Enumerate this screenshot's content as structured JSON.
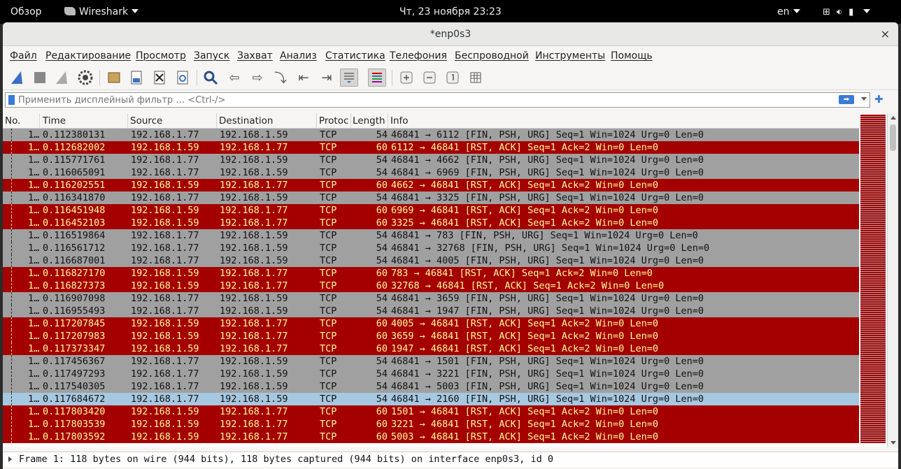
{
  "topbar": {
    "overview": "Обзор",
    "app_name": "Wireshark",
    "clock": "Чт, 23 ноября  23:23",
    "lang": "en"
  },
  "window": {
    "title": "*enp0s3",
    "close": "×"
  },
  "menu": [
    "Файл",
    "Редактирование",
    "Просмотр",
    "Запуск",
    "Захват",
    "Анализ",
    "Статистика",
    "Телефония",
    "Беспроводной",
    "Инструменты",
    "Помощь"
  ],
  "filter": {
    "placeholder": "Применить дисплейный фильтр … <Ctrl-/>"
  },
  "columns": [
    "No.",
    "Time",
    "Source",
    "Destination",
    "Protoc",
    "Length",
    "Info"
  ],
  "colors": {
    "syn_row_bg": "#a0a0a0",
    "rst_row_bg": "#a40000",
    "rst_row_fg": "#fffc9c",
    "selected_row_bg": "#a6c8e0"
  },
  "packets": [
    {
      "no": "1…",
      "time": "0.112380131",
      "src": "192.168.1.77",
      "dst": "192.168.1.59",
      "proto": "TCP",
      "len": "54",
      "info": "46841 → 6112 [FIN, PSH, URG] Seq=1 Win=1024 Urg=0 Len=0",
      "kind": "syn"
    },
    {
      "no": "1…",
      "time": "0.112682002",
      "src": "192.168.1.59",
      "dst": "192.168.1.77",
      "proto": "TCP",
      "len": "60",
      "info": "6112 → 46841 [RST, ACK] Seq=1 Ack=2 Win=0 Len=0",
      "kind": "rst"
    },
    {
      "no": "1…",
      "time": "0.115771761",
      "src": "192.168.1.77",
      "dst": "192.168.1.59",
      "proto": "TCP",
      "len": "54",
      "info": "46841 → 4662 [FIN, PSH, URG] Seq=1 Win=1024 Urg=0 Len=0",
      "kind": "syn"
    },
    {
      "no": "1…",
      "time": "0.116065091",
      "src": "192.168.1.77",
      "dst": "192.168.1.59",
      "proto": "TCP",
      "len": "54",
      "info": "46841 → 6969 [FIN, PSH, URG] Seq=1 Win=1024 Urg=0 Len=0",
      "kind": "syn"
    },
    {
      "no": "1…",
      "time": "0.116202551",
      "src": "192.168.1.59",
      "dst": "192.168.1.77",
      "proto": "TCP",
      "len": "60",
      "info": "4662 → 46841 [RST, ACK] Seq=1 Ack=2 Win=0 Len=0",
      "kind": "rst"
    },
    {
      "no": "1…",
      "time": "0.116341870",
      "src": "192.168.1.77",
      "dst": "192.168.1.59",
      "proto": "TCP",
      "len": "54",
      "info": "46841 → 3325 [FIN, PSH, URG] Seq=1 Win=1024 Urg=0 Len=0",
      "kind": "syn"
    },
    {
      "no": "1…",
      "time": "0.116451948",
      "src": "192.168.1.59",
      "dst": "192.168.1.77",
      "proto": "TCP",
      "len": "60",
      "info": "6969 → 46841 [RST, ACK] Seq=1 Ack=2 Win=0 Len=0",
      "kind": "rst"
    },
    {
      "no": "1…",
      "time": "0.116452103",
      "src": "192.168.1.59",
      "dst": "192.168.1.77",
      "proto": "TCP",
      "len": "60",
      "info": "3325 → 46841 [RST, ACK] Seq=1 Ack=2 Win=0 Len=0",
      "kind": "rst"
    },
    {
      "no": "1…",
      "time": "0.116519864",
      "src": "192.168.1.77",
      "dst": "192.168.1.59",
      "proto": "TCP",
      "len": "54",
      "info": "46841 → 783 [FIN, PSH, URG] Seq=1 Win=1024 Urg=0 Len=0",
      "kind": "syn"
    },
    {
      "no": "1…",
      "time": "0.116561712",
      "src": "192.168.1.77",
      "dst": "192.168.1.59",
      "proto": "TCP",
      "len": "54",
      "info": "46841 → 32768 [FIN, PSH, URG] Seq=1 Win=1024 Urg=0 Len=0",
      "kind": "syn"
    },
    {
      "no": "1…",
      "time": "0.116687001",
      "src": "192.168.1.77",
      "dst": "192.168.1.59",
      "proto": "TCP",
      "len": "54",
      "info": "46841 → 4005 [FIN, PSH, URG] Seq=1 Win=1024 Urg=0 Len=0",
      "kind": "syn"
    },
    {
      "no": "1…",
      "time": "0.116827170",
      "src": "192.168.1.59",
      "dst": "192.168.1.77",
      "proto": "TCP",
      "len": "60",
      "info": "783 → 46841 [RST, ACK] Seq=1 Ack=2 Win=0 Len=0",
      "kind": "rst"
    },
    {
      "no": "1…",
      "time": "0.116827373",
      "src": "192.168.1.59",
      "dst": "192.168.1.77",
      "proto": "TCP",
      "len": "60",
      "info": "32768 → 46841 [RST, ACK] Seq=1 Ack=2 Win=0 Len=0",
      "kind": "rst"
    },
    {
      "no": "1…",
      "time": "0.116907098",
      "src": "192.168.1.77",
      "dst": "192.168.1.59",
      "proto": "TCP",
      "len": "54",
      "info": "46841 → 3659 [FIN, PSH, URG] Seq=1 Win=1024 Urg=0 Len=0",
      "kind": "syn"
    },
    {
      "no": "1…",
      "time": "0.116955493",
      "src": "192.168.1.77",
      "dst": "192.168.1.59",
      "proto": "TCP",
      "len": "54",
      "info": "46841 → 1947 [FIN, PSH, URG] Seq=1 Win=1024 Urg=0 Len=0",
      "kind": "syn"
    },
    {
      "no": "1…",
      "time": "0.117207845",
      "src": "192.168.1.59",
      "dst": "192.168.1.77",
      "proto": "TCP",
      "len": "60",
      "info": "4005 → 46841 [RST, ACK] Seq=1 Ack=2 Win=0 Len=0",
      "kind": "rst"
    },
    {
      "no": "1…",
      "time": "0.117207983",
      "src": "192.168.1.59",
      "dst": "192.168.1.77",
      "proto": "TCP",
      "len": "60",
      "info": "3659 → 46841 [RST, ACK] Seq=1 Ack=2 Win=0 Len=0",
      "kind": "rst"
    },
    {
      "no": "1…",
      "time": "0.117373347",
      "src": "192.168.1.59",
      "dst": "192.168.1.77",
      "proto": "TCP",
      "len": "60",
      "info": "1947 → 46841 [RST, ACK] Seq=1 Ack=2 Win=0 Len=0",
      "kind": "rst"
    },
    {
      "no": "1…",
      "time": "0.117456367",
      "src": "192.168.1.77",
      "dst": "192.168.1.59",
      "proto": "TCP",
      "len": "54",
      "info": "46841 → 1501 [FIN, PSH, URG] Seq=1 Win=1024 Urg=0 Len=0",
      "kind": "syn"
    },
    {
      "no": "1…",
      "time": "0.117497293",
      "src": "192.168.1.77",
      "dst": "192.168.1.59",
      "proto": "TCP",
      "len": "54",
      "info": "46841 → 3221 [FIN, PSH, URG] Seq=1 Win=1024 Urg=0 Len=0",
      "kind": "syn"
    },
    {
      "no": "1…",
      "time": "0.117540305",
      "src": "192.168.1.77",
      "dst": "192.168.1.59",
      "proto": "TCP",
      "len": "54",
      "info": "46841 → 5003 [FIN, PSH, URG] Seq=1 Win=1024 Urg=0 Len=0",
      "kind": "syn"
    },
    {
      "no": "1…",
      "time": "0.117684672",
      "src": "192.168.1.77",
      "dst": "192.168.1.59",
      "proto": "TCP",
      "len": "54",
      "info": "46841 → 2160 [FIN, PSH, URG] Seq=1 Win=1024 Urg=0 Len=0",
      "kind": "sel"
    },
    {
      "no": "1…",
      "time": "0.117803420",
      "src": "192.168.1.59",
      "dst": "192.168.1.77",
      "proto": "TCP",
      "len": "60",
      "info": "1501 → 46841 [RST, ACK] Seq=1 Ack=2 Win=0 Len=0",
      "kind": "rst"
    },
    {
      "no": "1…",
      "time": "0.117803539",
      "src": "192.168.1.59",
      "dst": "192.168.1.77",
      "proto": "TCP",
      "len": "60",
      "info": "3221 → 46841 [RST, ACK] Seq=1 Ack=2 Win=0 Len=0",
      "kind": "rst"
    },
    {
      "no": "1…",
      "time": "0.117803592",
      "src": "192.168.1.59",
      "dst": "192.168.1.77",
      "proto": "TCP",
      "len": "60",
      "info": "5003 → 46841 [RST, ACK] Seq=1 Ack=2 Win=0 Len=0",
      "kind": "rst"
    }
  ],
  "detail": {
    "frame_summary": "Frame 1: 118 bytes on wire (944 bits), 118 bytes captured (944 bits) on interface enp0s3, id 0"
  }
}
